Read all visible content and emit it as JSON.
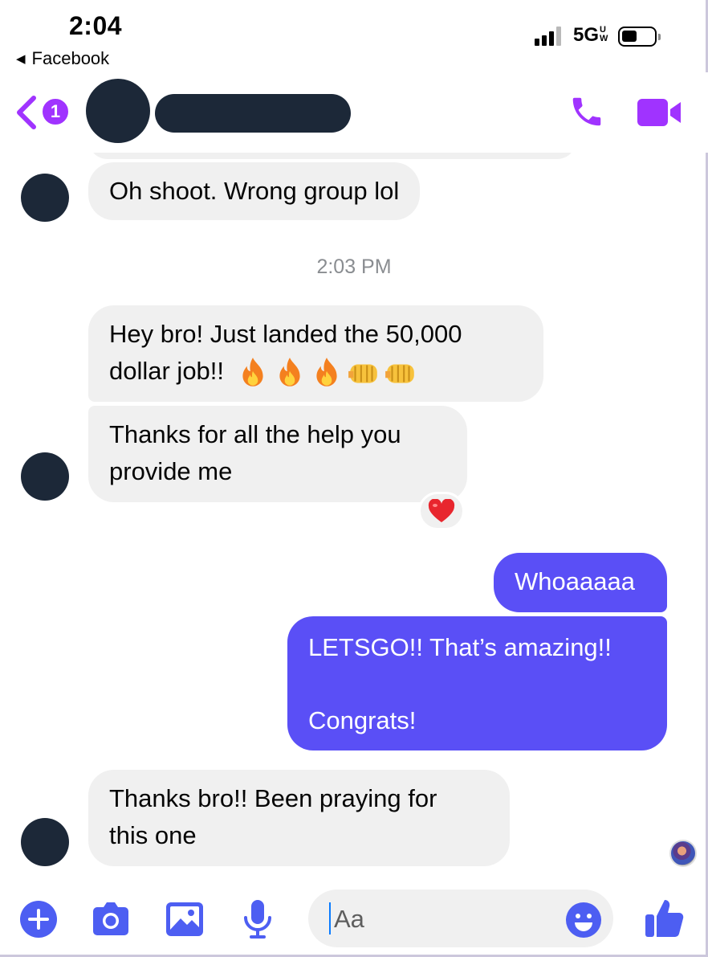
{
  "status_bar": {
    "time": "2:04",
    "back_label": "Facebook",
    "network": "5G",
    "network_superscript_top": "U",
    "network_superscript_bottom": "W"
  },
  "header": {
    "unread_count": "1",
    "accent_color": "#a033ff"
  },
  "thread": {
    "messages": [
      {
        "sender": "contact",
        "text": "Oh shoot. Wrong group lol"
      },
      {
        "sender": "system",
        "text": "2:03 PM"
      },
      {
        "sender": "contact",
        "line1": "Hey bro! Just landed the 50,000",
        "line2": "dollar job!!",
        "emojis": [
          "fire-emoji",
          "fire-emoji",
          "fire-emoji",
          "fist-bump-emoji",
          "fist-bump-emoji"
        ]
      },
      {
        "sender": "contact",
        "line1": "Thanks for all the help you",
        "line2": "provide me",
        "reaction": "red-heart-emoji"
      },
      {
        "sender": "me",
        "text": "Whoaaaaa"
      },
      {
        "sender": "me",
        "line1": "LETSGO!! That’s amazing!!",
        "line2": "Congrats!"
      },
      {
        "sender": "contact",
        "line1": "Thanks bro!! Been praying for",
        "line2": "this one"
      }
    ],
    "outgoing_color": "#5a4ff6",
    "incoming_color": "#f0f0f0"
  },
  "composer": {
    "placeholder": "Aa",
    "icons": [
      "plus-icon",
      "camera-icon",
      "gallery-icon",
      "microphone-icon",
      "emoji-icon",
      "thumbs-up-icon"
    ],
    "icon_color": "#4d5ef2"
  }
}
